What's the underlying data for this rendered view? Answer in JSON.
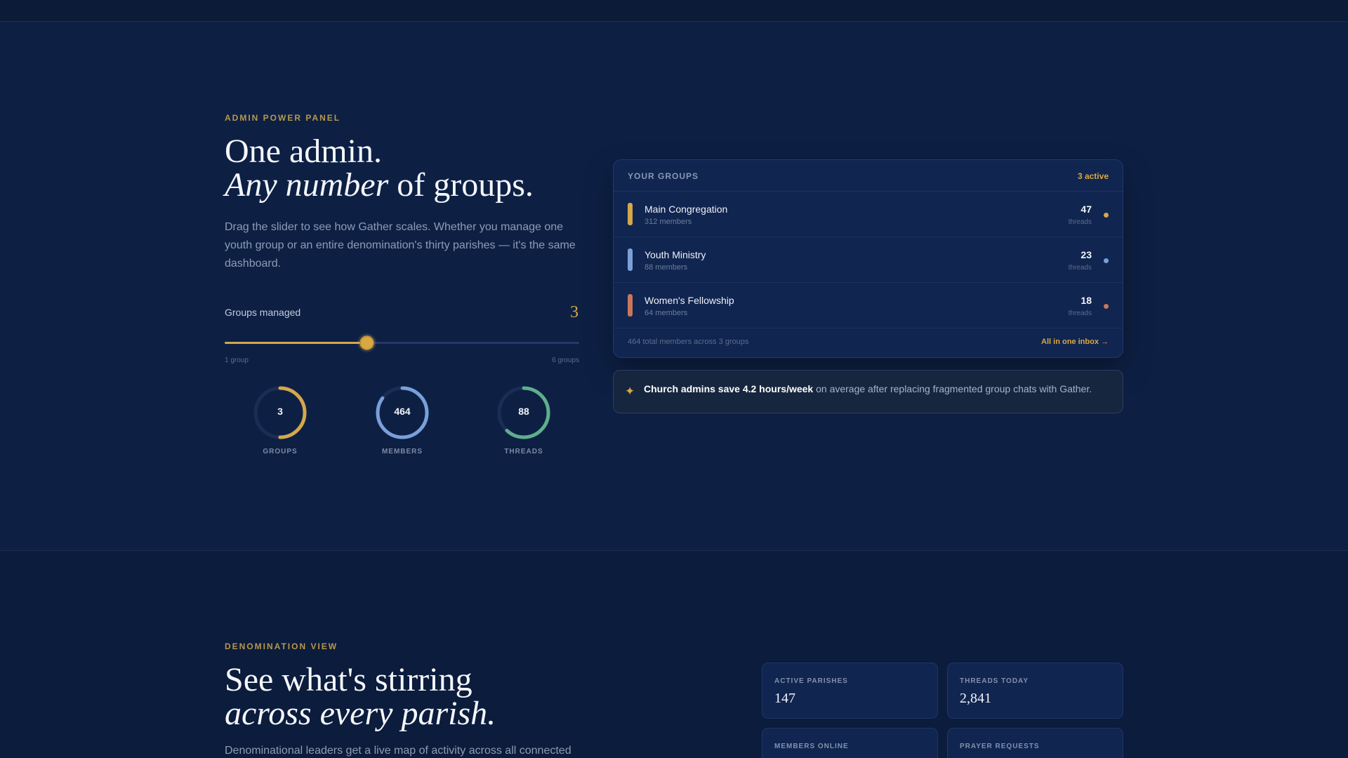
{
  "admin": {
    "eyebrow": "ADMIN POWER PANEL",
    "headline_line1": "One admin.",
    "headline_italic": "Any number",
    "headline_rest": " of groups.",
    "lede": "Drag the slider to see how Gather scales. Whether you manage one youth group or an entire denomination's thirty parishes — it's the same dashboard.",
    "slider": {
      "label": "Groups managed",
      "value": "3",
      "min_label": "1 group",
      "max_label": "6 groups",
      "min": 1,
      "max": 6,
      "current": 3
    },
    "rings": [
      {
        "value": "3",
        "label": "GROUPS",
        "color": "#d4a84b",
        "fraction": 0.5
      },
      {
        "value": "464",
        "label": "MEMBERS",
        "color": "#7aa0d8",
        "fraction": 0.85
      },
      {
        "value": "88",
        "label": "THREADS",
        "color": "#5fae8c",
        "fraction": 0.62
      }
    ]
  },
  "groups_card": {
    "title": "YOUR GROUPS",
    "active": "3 active",
    "groups": [
      {
        "name": "Main Congregation",
        "members": "312 members",
        "threads": "47",
        "unit": "threads",
        "color": "#d4a84b"
      },
      {
        "name": "Youth Ministry",
        "members": "88 members",
        "threads": "23",
        "unit": "threads",
        "color": "#7aa0d8"
      },
      {
        "name": "Women's Fellowship",
        "members": "64 members",
        "threads": "18",
        "unit": "threads",
        "color": "#c9765b"
      }
    ],
    "footer_left": "464 total members across 3 groups",
    "footer_link": "All in one inbox →"
  },
  "tip": {
    "icon": "sparkle-icon",
    "bold": "Church admins save 4.2 hours/week",
    "rest": " on average after replacing fragmented group chats with Gather."
  },
  "denomination": {
    "eyebrow": "DENOMINATION VIEW",
    "headline_line1": "See what's stirring",
    "headline_line2": "across every parish.",
    "lede": "Denominational leaders get a live map of activity across all connected",
    "stats": [
      {
        "label": "ACTIVE PARISHES",
        "value": "147"
      },
      {
        "label": "THREADS TODAY",
        "value": "2,841"
      },
      {
        "label": "MEMBERS ONLINE",
        "value": ""
      },
      {
        "label": "PRAYER REQUESTS",
        "value": ""
      }
    ]
  }
}
